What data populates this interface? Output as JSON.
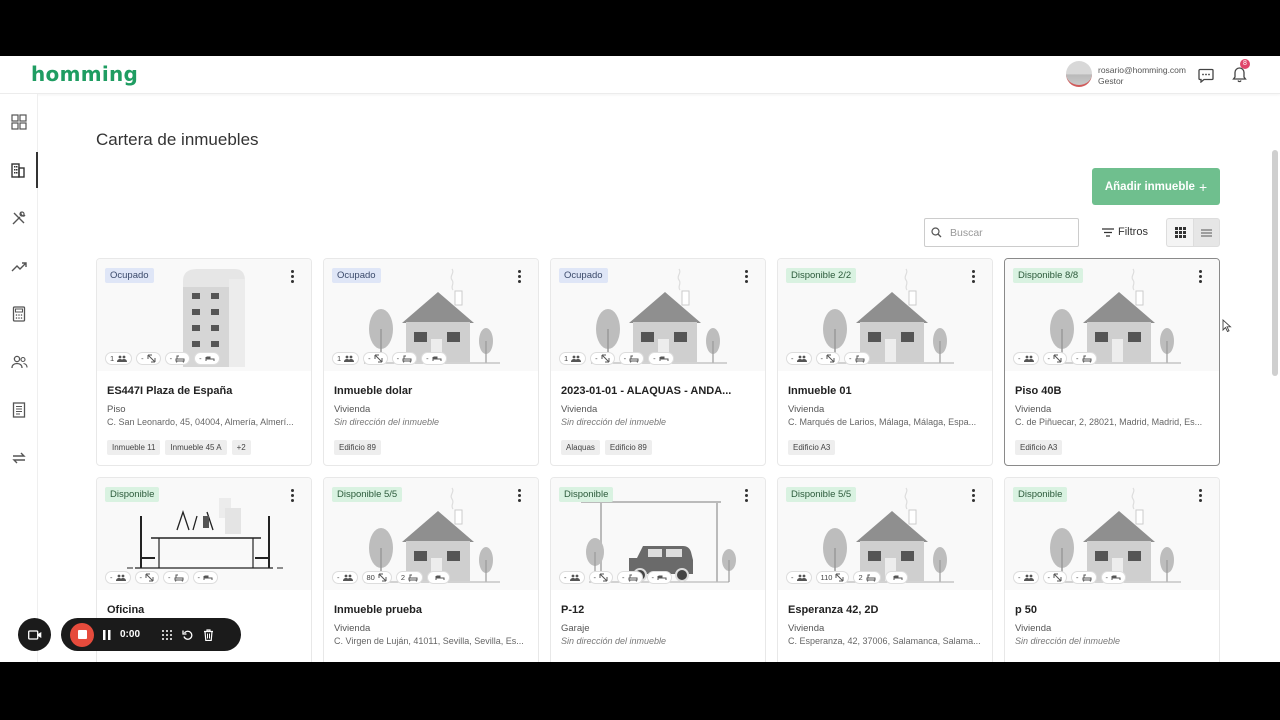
{
  "app": {
    "logo": "homming"
  },
  "user": {
    "email": "rosario@homming.com",
    "role": "Gestor",
    "notifications": "8"
  },
  "page": {
    "title": "Cartera de inmuebles"
  },
  "toolbar": {
    "add_label": "Añadir inmueble",
    "add_icon": "+",
    "search_placeholder": "Buscar",
    "filters_label": "Filtros"
  },
  "sidebar": {
    "items": [
      "dashboard-icon",
      "buildings-icon",
      "tools-icon",
      "trend-icon",
      "calculator-icon",
      "people-icon",
      "documents-icon",
      "transfer-icon"
    ]
  },
  "cards": [
    {
      "status": "Ocupado",
      "name": "ES447I Plaza de España",
      "type": "Piso",
      "address": "C. San Leonardo, 45, 04004, Almería, Almerí...",
      "tags": [
        "Inmueble 11",
        "Inmueble 45 A",
        "+2"
      ],
      "chips": [
        "1",
        "-",
        "-",
        "-"
      ],
      "image": "building"
    },
    {
      "status": "Ocupado",
      "name": "Inmueble dolar",
      "type": "Vivienda",
      "address": "Sin dirección del inmueble",
      "tags": [
        "Edificio 89"
      ],
      "chips": [
        "1",
        "-",
        "-",
        "-"
      ],
      "image": "house"
    },
    {
      "status": "Ocupado",
      "name": "2023-01-01 - ALAQUAS - ANDA...",
      "type": "Vivienda",
      "address": "Sin dirección del inmueble",
      "tags": [
        "Alaquas",
        "Edificio 89"
      ],
      "chips": [
        "1",
        "-",
        "-",
        "-"
      ],
      "image": "house"
    },
    {
      "status": "Disponible 2/2",
      "name": "Inmueble 01",
      "type": "Vivienda",
      "address": "C. Marqués de Larios, Málaga, Málaga, Espa...",
      "tags": [
        "Edificio A3"
      ],
      "chips": [
        "-",
        "-",
        "-"
      ],
      "image": "house"
    },
    {
      "status": "Disponible 8/8",
      "name": "Piso 40B",
      "type": "Vivienda",
      "address": "C. de Piñuecar, 2, 28021, Madrid, Madrid, Es...",
      "tags": [
        "Edificio A3"
      ],
      "chips": [
        "-",
        "-",
        "-"
      ],
      "image": "house"
    },
    {
      "status": "Disponible",
      "name": "Oficina",
      "type": "",
      "address": "",
      "tags": [],
      "chips": [
        "-",
        "-",
        "-",
        "-"
      ],
      "image": "office"
    },
    {
      "status": "Disponible 5/5",
      "name": "Inmueble prueba",
      "type": "Vivienda",
      "address": "C. Virgen de Luján, 41011, Sevilla, Sevilla, Es...",
      "tags": [],
      "chips": [
        "-",
        "80",
        "2",
        ""
      ],
      "image": "house"
    },
    {
      "status": "Disponible",
      "name": "P-12",
      "type": "Garaje",
      "address": "Sin dirección del inmueble",
      "tags": [],
      "chips": [
        "-",
        "-",
        "-",
        "-"
      ],
      "image": "garage"
    },
    {
      "status": "Disponible 5/5",
      "name": "Esperanza 42, 2D",
      "type": "Vivienda",
      "address": "C. Esperanza, 42, 37006, Salamanca, Salama...",
      "tags": [],
      "chips": [
        "-",
        "110",
        "2",
        ""
      ],
      "image": "house"
    },
    {
      "status": "Disponible",
      "name": "p 50",
      "type": "Vivienda",
      "address": "Sin dirección del inmueble",
      "tags": [],
      "chips": [
        "-",
        "-",
        "-",
        "-"
      ],
      "image": "house"
    }
  ],
  "recorder": {
    "time": "0:00"
  }
}
